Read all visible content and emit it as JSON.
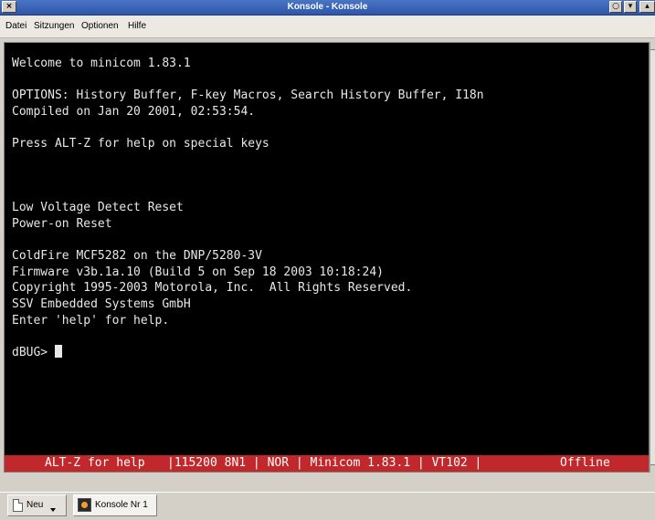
{
  "window": {
    "title": "Konsole - Konsole",
    "buttons": {
      "close": "×",
      "options": "○",
      "minimize": "▾",
      "maximize": "▴"
    }
  },
  "menu": {
    "items": [
      "Datei",
      "Sitzungen",
      "Optionen",
      "Hilfe"
    ]
  },
  "terminal": {
    "lines": [
      "Welcome to minicom 1.83.1",
      "",
      "OPTIONS: History Buffer, F-key Macros, Search History Buffer, I18n",
      "Compiled on Jan 20 2001, 02:53:54.",
      "",
      "Press ALT-Z for help on special keys",
      "",
      "",
      "",
      "Low Voltage Detect Reset",
      "Power-on Reset",
      "",
      "ColdFire MCF5282 on the DNP/5280-3V",
      "Firmware v3b.1a.10 (Build 5 on Sep 18 2003 10:18:24)",
      "Copyright 1995-2003 Motorola, Inc.  All Rights Reserved.",
      "SSV Embedded Systems GmbH",
      "Enter 'help' for help.",
      ""
    ],
    "prompt": "dBUG> ",
    "status_line": {
      "help": "ALT-Z for help",
      "settings": "|115200 8N1 | NOR | Minicom 1.83.1 | VT102 |",
      "state": "Offline"
    }
  },
  "session_bar": {
    "new_label": "Neu",
    "session_label": "Konsole Nr 1"
  },
  "colors": {
    "terminal_bg": "#000000",
    "terminal_fg": "#e8e8e8",
    "status_bg": "#c0282c",
    "titlebar": "#3a64b8"
  }
}
